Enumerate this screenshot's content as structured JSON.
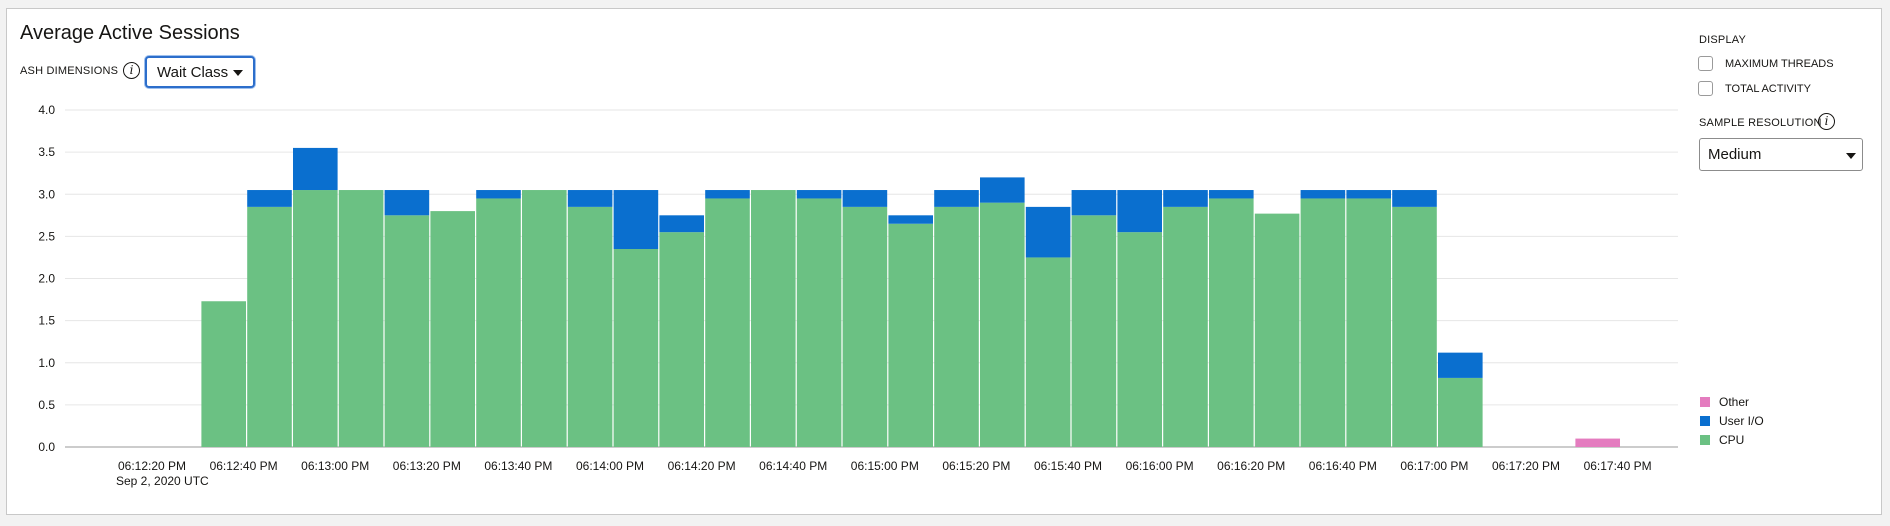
{
  "panel": {
    "title": "Average Active Sessions",
    "ash_label": "ASH DIMENSIONS",
    "dimension_value": "Wait Class",
    "info_glyph": "i"
  },
  "right": {
    "display_heading": "DISPLAY",
    "checkboxes": [
      {
        "label": "MAXIMUM THREADS",
        "checked": false
      },
      {
        "label": "TOTAL ACTIVITY",
        "checked": false
      }
    ],
    "resolution_heading": "SAMPLE RESOLUTION",
    "resolution_value": "Medium"
  },
  "chart_data": {
    "type": "bar",
    "stacked": true,
    "ylim": [
      0,
      4
    ],
    "yticks": [
      "0.0",
      "0.5",
      "1.0",
      "1.5",
      "2.0",
      "2.5",
      "3.0",
      "3.5",
      "4.0"
    ],
    "xtick_labels": [
      "06:12:20 PM",
      "06:12:40 PM",
      "06:13:00 PM",
      "06:13:20 PM",
      "06:13:40 PM",
      "06:14:00 PM",
      "06:14:20 PM",
      "06:14:40 PM",
      "06:15:00 PM",
      "06:15:20 PM",
      "06:15:40 PM",
      "06:16:00 PM",
      "06:16:20 PM",
      "06:16:40 PM",
      "06:17:00 PM",
      "06:17:20 PM",
      "06:17:40 PM"
    ],
    "x_sublabel": "Sep 2, 2020 UTC",
    "grid": true,
    "legend_position": "bottom-right",
    "series": [
      {
        "name": "CPU",
        "color": "#6bc183",
        "values": [
          0,
          0,
          0,
          1.73,
          2.85,
          3.05,
          3.05,
          2.75,
          2.8,
          2.95,
          3.05,
          2.85,
          2.35,
          2.55,
          2.95,
          3.05,
          2.95,
          2.85,
          2.65,
          2.85,
          2.9,
          2.25,
          2.75,
          2.55,
          2.85,
          2.95,
          2.77,
          2.95,
          2.95,
          2.85,
          0.82,
          0,
          0,
          0,
          0
        ]
      },
      {
        "name": "User I/O",
        "color": "#0a6fcf",
        "values": [
          0,
          0,
          0,
          0,
          0.2,
          0.5,
          0,
          0.3,
          0,
          0.1,
          0,
          0.2,
          0.7,
          0.2,
          0.1,
          0,
          0.1,
          0.2,
          0.1,
          0.2,
          0.3,
          0.6,
          0.3,
          0.5,
          0.2,
          0.1,
          0,
          0.1,
          0.1,
          0.2,
          0.3,
          0,
          0,
          0,
          0
        ]
      },
      {
        "name": "Other",
        "color": "#e47cbf",
        "values": [
          0,
          0,
          0,
          0,
          0,
          0,
          0,
          0,
          0,
          0,
          0,
          0,
          0,
          0,
          0,
          0,
          0,
          0,
          0,
          0,
          0,
          0,
          0,
          0,
          0,
          0,
          0,
          0,
          0,
          0,
          0,
          0,
          0,
          0.1,
          0
        ]
      }
    ]
  }
}
